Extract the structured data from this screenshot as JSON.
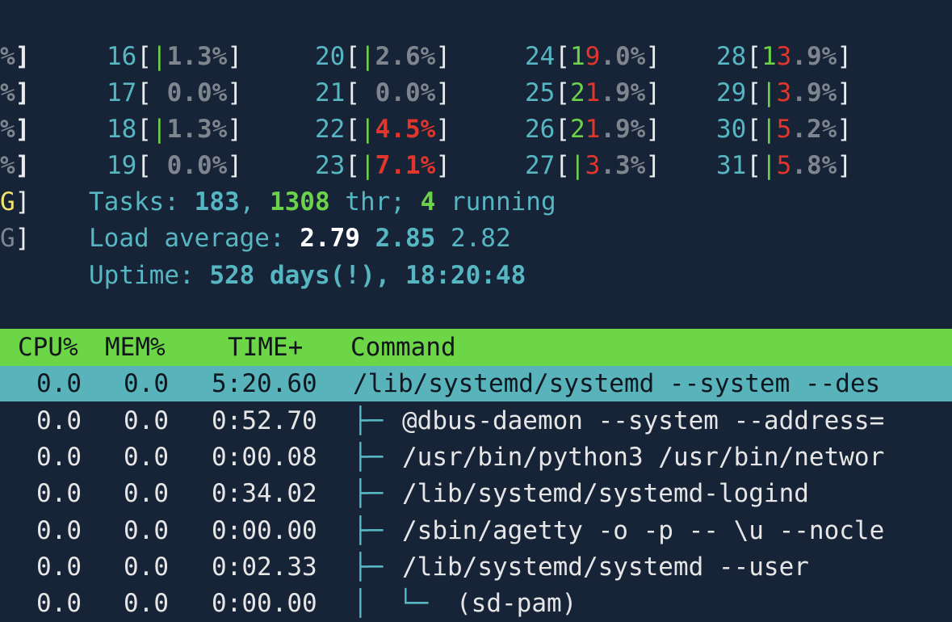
{
  "meters": {
    "left_edge": [
      {
        "pct": "%",
        "close": "]"
      },
      {
        "pct": "%",
        "close": "]"
      },
      {
        "pct": "%",
        "close": "]"
      },
      {
        "pct": "%",
        "close": "]"
      },
      {
        "pct": "G",
        "close": "]"
      },
      {
        "pct": "G",
        "close": "]"
      }
    ],
    "cpus": [
      {
        "id": "16",
        "bar": "|",
        "val": "1.3%"
      },
      {
        "id": "17",
        "bar": " ",
        "val": "0.0%"
      },
      {
        "id": "18",
        "bar": "|",
        "val": "1.3%"
      },
      {
        "id": "19",
        "bar": " ",
        "val": "0.0%"
      },
      {
        "id": "20",
        "bar": "|",
        "val": "2.6%"
      },
      {
        "id": "21",
        "bar": " ",
        "val": "0.0%"
      },
      {
        "id": "22",
        "bar": "|",
        "val": "4.5%"
      },
      {
        "id": "23",
        "bar": "|",
        "val": "7.1%"
      },
      {
        "id": "24",
        "g": "1",
        "r": "9",
        "val": ".0%"
      },
      {
        "id": "25",
        "g": "2",
        "r": "1",
        "val": ".9%"
      },
      {
        "id": "26",
        "g": "2",
        "r": "1",
        "val": ".9%"
      },
      {
        "id": "27",
        "bar": "|",
        "r": "3",
        "val": ".3%"
      },
      {
        "id": "28",
        "g": "1",
        "r": "3",
        "val": ".9%"
      },
      {
        "id": "29",
        "bar": "|",
        "r": "3",
        "val": ".9%"
      },
      {
        "id": "30",
        "bar": "|",
        "r": "5",
        "val": ".2%"
      },
      {
        "id": "31",
        "bar": "|",
        "r": "5",
        "val": ".8%"
      }
    ]
  },
  "tasks": {
    "label": "Tasks: ",
    "count": "183",
    "comma": ", ",
    "threads": "1308",
    "thr_label": " thr; ",
    "running": "4",
    "running_label": " running"
  },
  "load": {
    "label": "Load average: ",
    "l1": "2.79",
    "l5": "2.85",
    "l15": "2.82"
  },
  "uptime": {
    "label": "Uptime: ",
    "value": "528 days(!), 18:20:48"
  },
  "table": {
    "header": {
      "cpu": "CPU%",
      "mem": "MEM%",
      "time": "TIME+",
      "command": "Command"
    },
    "rows": [
      {
        "cpu": "0.0",
        "mem": "0.0",
        "time": "5:20.60",
        "tree": "",
        "command": "/lib/systemd/systemd --system --des"
      },
      {
        "cpu": "0.0",
        "mem": "0.0",
        "time": "0:52.70",
        "tree": "├─ ",
        "command": "@dbus-daemon --system --address="
      },
      {
        "cpu": "0.0",
        "mem": "0.0",
        "time": "0:00.08",
        "tree": "├─ ",
        "command": "/usr/bin/python3 /usr/bin/networ"
      },
      {
        "cpu": "0.0",
        "mem": "0.0",
        "time": "0:34.02",
        "tree": "├─ ",
        "command": "/lib/systemd/systemd-logind"
      },
      {
        "cpu": "0.0",
        "mem": "0.0",
        "time": "0:00.00",
        "tree": "├─ ",
        "command": "/sbin/agetty -o -p -- \\u --nocle"
      },
      {
        "cpu": "0.0",
        "mem": "0.0",
        "time": "0:02.33",
        "tree": "├─ ",
        "command": "/lib/systemd/systemd --user"
      },
      {
        "cpu": "0.0",
        "mem": "0.0",
        "time": "0:00.00",
        "tree": "│  └─ ",
        "command": "(sd-pam)"
      }
    ]
  },
  "colors": {
    "background": "#172337",
    "teal": "#56b6c2",
    "green": "#6bd24a",
    "red": "#e0362c",
    "header_bg": "#6dd646",
    "selected_bg": "#58b3bb"
  }
}
